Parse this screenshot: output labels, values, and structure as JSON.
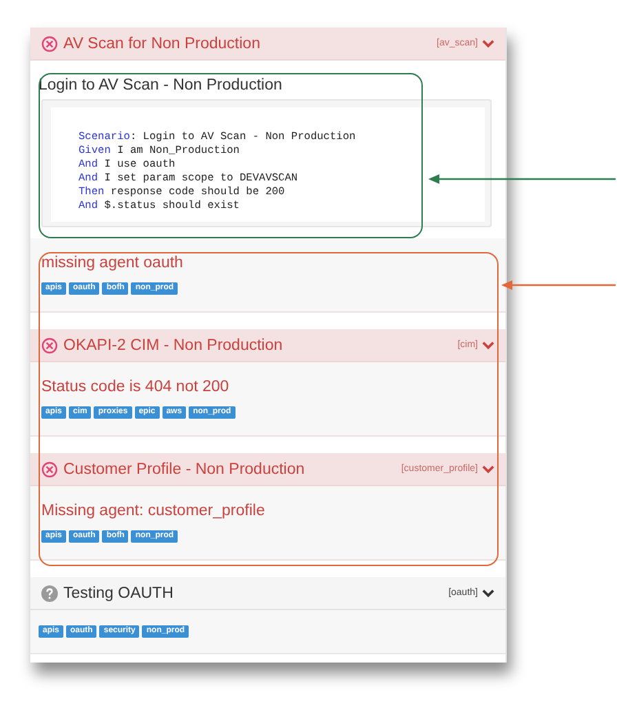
{
  "features": [
    {
      "failed": true,
      "title": "AV Scan for Non Production",
      "tag": "[av_scan]",
      "items": [
        {
          "kind": "scenario",
          "title": "Login to AV Scan - Non Production",
          "steps": [
            {
              "keyword": "Scenario",
              "text": ": Login to AV Scan - Non Production"
            },
            {
              "keyword": "Given",
              "text": " I am Non_Production"
            },
            {
              "keyword": "And",
              "text": " I use oauth"
            },
            {
              "keyword": "And",
              "text": " I set param scope to DEVAVSCAN"
            },
            {
              "keyword": "Then",
              "text": " response code should be 200"
            },
            {
              "keyword": "And",
              "text": " $.status should exist"
            }
          ]
        },
        {
          "kind": "error",
          "message": "missing agent oauth",
          "tags": [
            "apis",
            "oauth",
            "bofh",
            "non_prod"
          ]
        }
      ]
    },
    {
      "failed": true,
      "title": "OKAPI-2 CIM - Non Production",
      "tag": "[cim]",
      "items": [
        {
          "kind": "error",
          "message": "Status code is 404 not 200",
          "tags": [
            "apis",
            "cim",
            "proxies",
            "epic",
            "aws",
            "non_prod"
          ]
        }
      ]
    },
    {
      "failed": true,
      "title": "Customer Profile - Non Production",
      "tag": "[customer_profile]",
      "items": [
        {
          "kind": "error",
          "message": "Missing agent: customer_profile",
          "tags": [
            "apis",
            "oauth",
            "bofh",
            "non_prod"
          ]
        }
      ]
    },
    {
      "failed": false,
      "title": "Testing OAUTH",
      "tag": "[oauth]",
      "items": [
        {
          "kind": "tags",
          "tags": [
            "apis",
            "oauth",
            "security",
            "non_prod"
          ]
        }
      ]
    }
  ],
  "callouts": [
    {
      "color": "#2e7d4f"
    },
    {
      "color": "#e0683a"
    }
  ]
}
